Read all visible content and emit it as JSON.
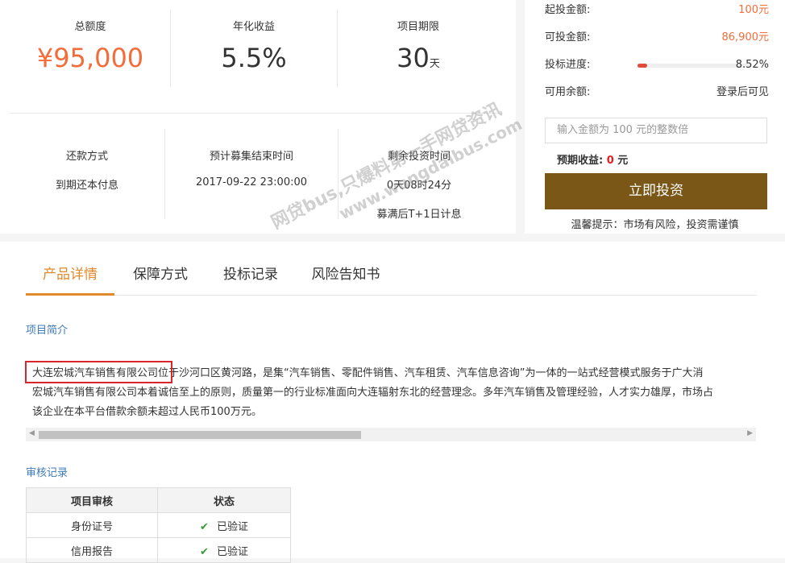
{
  "summary": {
    "total_label": "总额度",
    "total_value": "¥95,000",
    "rate_label": "年化收益",
    "rate_value": "5.5%",
    "term_label": "项目期限",
    "term_value": "30",
    "term_unit": "天"
  },
  "details": {
    "repay_label": "还款方式",
    "repay_value": "到期还本付息",
    "end_label": "预计募集结束时间",
    "end_value": "2017-09-22 23:00:00",
    "remain_label": "剩余投资时间",
    "remain_value": "0天08时24分",
    "interest_note": "募满后T+1日计息"
  },
  "invest": {
    "min_label": "起投金额:",
    "min_value": "100元",
    "avail_label": "可投金额:",
    "avail_value": "86,900元",
    "progress_label": "投标进度:",
    "progress_value": "8.52%",
    "progress_fraction": 0.0852,
    "balance_label": "可用余额:",
    "balance_value": "登录后可见",
    "amount_placeholder": "输入金额为 100 元的整数倍",
    "expected_label": "预期收益: ",
    "expected_value": "0",
    "expected_unit": " 元",
    "button": "立即投资",
    "tip": "温馨提示：市场有风险，投资需谨慎"
  },
  "tabs": [
    "产品详情",
    "保障方式",
    "投标记录",
    "风险告知书"
  ],
  "intro": {
    "title": "项目简介",
    "company": "大连宏城汽车销售有限公司",
    "line1_rest": "位于沙河口区黄河路，是集“汽车销售、零配件销售、汽车租赁、汽车信息咨询”为一体的一站式经营模式服务于广大消",
    "line2": "宏城汽车销售有限公司本着诚信至上的原则，质量第一的行业标准面向大连辐射东北的经营理念。多年汽车销售及管理经验，人才实力雄厚，市场占",
    "line3": "该企业在本平台借款余额未超过人民币100万元。"
  },
  "audit": {
    "title": "审核记录",
    "headers": [
      "项目审核",
      "状态"
    ],
    "rows": [
      {
        "item": "身份证号",
        "status": "已验证"
      },
      {
        "item": "信用报告",
        "status": "已验证"
      }
    ]
  },
  "watermark": {
    "line1": "网贷bus,只爆料第一手网贷资讯",
    "line2": "www.wangdaibus.com"
  }
}
